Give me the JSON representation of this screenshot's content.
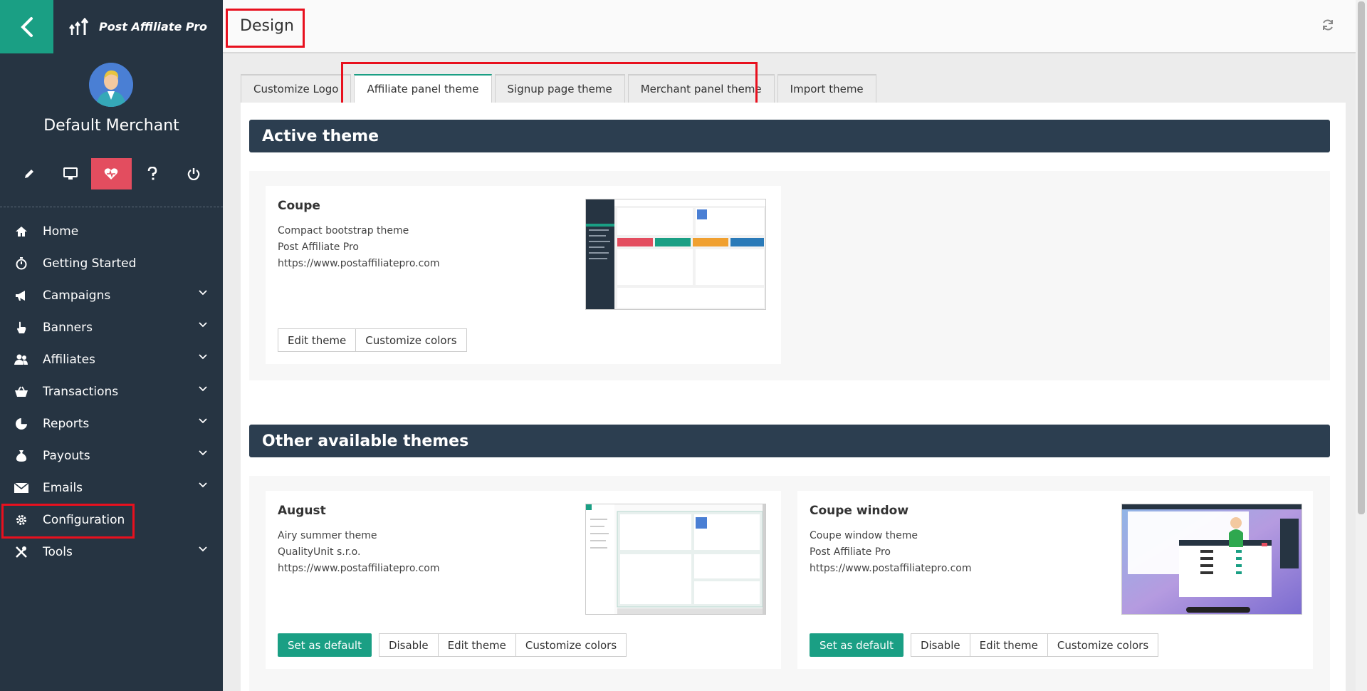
{
  "brand": {
    "name": "Post Affiliate Pro"
  },
  "user": {
    "name": "Default Merchant"
  },
  "sidebar": {
    "icons": [
      "pencil-icon",
      "monitor-icon",
      "heart-pulse-icon",
      "help-icon",
      "power-icon"
    ],
    "items": [
      {
        "label": "Home",
        "icon": "home-icon",
        "has_children": false
      },
      {
        "label": "Getting Started",
        "icon": "stopwatch-icon",
        "has_children": false
      },
      {
        "label": "Campaigns",
        "icon": "megaphone-icon",
        "has_children": true
      },
      {
        "label": "Banners",
        "icon": "pointer-hand-icon",
        "has_children": true
      },
      {
        "label": "Affiliates",
        "icon": "users-icon",
        "has_children": true
      },
      {
        "label": "Transactions",
        "icon": "basket-icon",
        "has_children": true
      },
      {
        "label": "Reports",
        "icon": "pie-chart-icon",
        "has_children": true
      },
      {
        "label": "Payouts",
        "icon": "money-bag-icon",
        "has_children": true
      },
      {
        "label": "Emails",
        "icon": "envelope-icon",
        "has_children": true
      },
      {
        "label": "Configuration",
        "icon": "gear-icon",
        "has_children": false
      },
      {
        "label": "Tools",
        "icon": "tools-icon",
        "has_children": true
      }
    ]
  },
  "header": {
    "title": "Design"
  },
  "tabs": [
    {
      "label": "Customize Logo",
      "active": false
    },
    {
      "label": "Affiliate panel theme",
      "active": true
    },
    {
      "label": "Signup page theme",
      "active": false
    },
    {
      "label": "Merchant panel theme",
      "active": false
    },
    {
      "label": "Import theme",
      "active": false
    }
  ],
  "active_section": {
    "heading": "Active theme",
    "theme": {
      "name": "Coupe",
      "description": "Compact bootstrap theme",
      "author": "Post Affiliate Pro",
      "url": "https://www.postaffiliatepro.com",
      "buttons": {
        "edit": "Edit theme",
        "colors": "Customize colors"
      }
    }
  },
  "other_section": {
    "heading": "Other available themes",
    "themes": [
      {
        "name": "August",
        "description": "Airy summer theme",
        "author": "QualityUnit s.r.o.",
        "url": "https://www.postaffiliatepro.com",
        "buttons": {
          "default": "Set as default",
          "disable": "Disable",
          "edit": "Edit theme",
          "colors": "Customize colors"
        }
      },
      {
        "name": "Coupe window",
        "description": "Coupe window theme",
        "author": "Post Affiliate Pro",
        "url": "https://www.postaffiliatepro.com",
        "buttons": {
          "default": "Set as default",
          "disable": "Disable",
          "edit": "Edit theme",
          "colors": "Customize colors"
        }
      }
    ]
  },
  "colors": {
    "sidebar": "#263442",
    "accent": "#1a9f84",
    "active_icon": "#e34d5f",
    "section_head": "#2c3e50",
    "highlight": "#e8101e"
  }
}
